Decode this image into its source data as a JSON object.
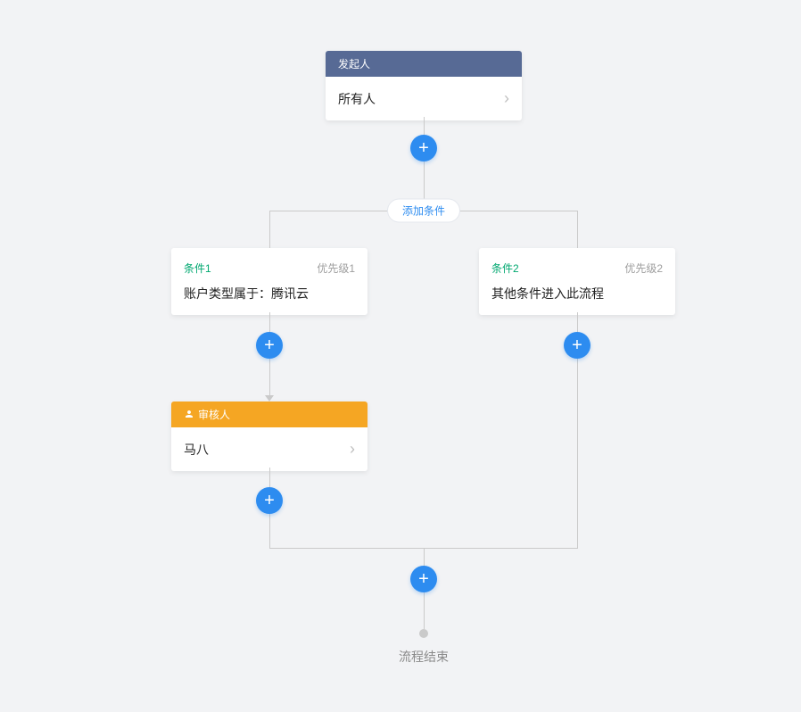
{
  "initiator": {
    "header": "发起人",
    "body": "所有人"
  },
  "addCondition": "添加条件",
  "branches": [
    {
      "name": "条件1",
      "priority": "优先级1",
      "desc": "账户类型属于：腾讯云"
    },
    {
      "name": "条件2",
      "priority": "优先级2",
      "desc": "其他条件进入此流程"
    }
  ],
  "approver": {
    "header": "审核人",
    "body": "马八"
  },
  "endLabel": "流程结束",
  "colors": {
    "headerBlue": "#576a95",
    "headerOrange": "#f5a623",
    "accent": "#2d8cf0",
    "condName": "#00a870"
  }
}
